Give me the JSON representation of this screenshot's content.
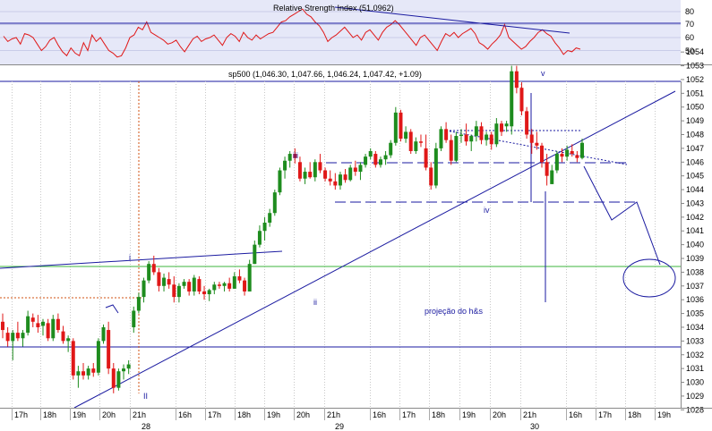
{
  "colors": {
    "rsi_bg": "#e6e8f8",
    "rsi_line": "#e01818",
    "up_candle": "#1e8c1e",
    "down_candle": "#e01818",
    "trendline": "#1a1aa0",
    "support_green": "#3cb43c",
    "fib_orange": "#d05010",
    "grid": "#c8c8c8"
  },
  "rsi_panel": {
    "title": "Relative Strength Index (51.0962)",
    "yticks": [
      "80",
      "70",
      "60",
      "50"
    ]
  },
  "price_panel": {
    "title": "sp500 (1,046.30, 1,047.66, 1,046.24, 1,047.42, +1.09)"
  },
  "annotations": {
    "wave_v": "v",
    "wave_iii": "iii",
    "wave_i": "i",
    "wave_ii_small": "ii",
    "wave_iv": "iv",
    "wave_II": "II",
    "projection": "projeção do h&s"
  },
  "chart_data": {
    "type": "candlestick",
    "title": "sp500 (1,046.30, 1,047.66, 1,046.24, 1,047.42, +1.09)",
    "interval": "hourly",
    "ylim": [
      1027.5,
      1055
    ],
    "yticks": [
      1028,
      1029,
      1030,
      1031,
      1032,
      1033,
      1034,
      1035,
      1036,
      1037,
      1038,
      1039,
      1040,
      1041,
      1042,
      1043,
      1044,
      1045,
      1046,
      1047,
      1048,
      1049,
      1050,
      1051,
      1052,
      1053,
      1054
    ],
    "xtick_labels": [
      "17h",
      "18h",
      "19h",
      "20h",
      "21h",
      "16h",
      "17h",
      "18h",
      "19h",
      "20h",
      "21h",
      "16h",
      "17h",
      "18h",
      "19h",
      "20h",
      "21h",
      "16h",
      "17h",
      "18h",
      "19h"
    ],
    "date_labels": [
      "28",
      "29",
      "30"
    ],
    "horizontal_levels": [
      1054.3,
      1038.7,
      1032.0
    ],
    "candles": [
      [
        1034.4,
        1035.0,
        1033.2,
        1033.8
      ],
      [
        1033.6,
        1034.0,
        1032.6,
        1033.0
      ],
      [
        1033.0,
        1033.8,
        1031.6,
        1033.6
      ],
      [
        1033.6,
        1034.4,
        1033.0,
        1033.2
      ],
      [
        1033.2,
        1033.8,
        1032.6,
        1033.6
      ],
      [
        1033.6,
        1035.2,
        1033.4,
        1034.8
      ],
      [
        1034.7,
        1035.0,
        1034.0,
        1034.4
      ],
      [
        1034.3,
        1034.9,
        1033.6,
        1034.0
      ],
      [
        1034.1,
        1034.6,
        1033.4,
        1034.4
      ],
      [
        1034.3,
        1034.6,
        1033.0,
        1033.2
      ],
      [
        1033.2,
        1034.9,
        1033.0,
        1034.6
      ],
      [
        1034.6,
        1035.0,
        1033.6,
        1033.8
      ],
      [
        1033.7,
        1034.1,
        1032.8,
        1033.0
      ],
      [
        1033.0,
        1033.4,
        1032.2,
        1033.2
      ],
      [
        1033.0,
        1033.2,
        1030.2,
        1030.5
      ],
      [
        1030.5,
        1031.2,
        1029.6,
        1030.8
      ],
      [
        1030.8,
        1031.4,
        1030.2,
        1030.5
      ],
      [
        1030.5,
        1031.2,
        1030.2,
        1031.0
      ],
      [
        1031.0,
        1031.4,
        1030.4,
        1030.7
      ],
      [
        1030.7,
        1033.2,
        1030.5,
        1033.0
      ],
      [
        1033.0,
        1034.2,
        1032.8,
        1034.0
      ],
      [
        1033.8,
        1034.4,
        1030.6,
        1031.0
      ],
      [
        1031.0,
        1031.4,
        1029.2,
        1029.6
      ],
      [
        1029.6,
        1031.0,
        1029.4,
        1030.8
      ],
      [
        1030.8,
        1031.3,
        1030.2,
        1031.0
      ],
      [
        1031.0,
        1031.6,
        1030.6,
        1031.3
      ],
      [
        1034.0,
        1035.5,
        1033.6,
        1035.2
      ],
      [
        1035.2,
        1036.5,
        1035.0,
        1036.2
      ],
      [
        1036.2,
        1037.6,
        1035.8,
        1037.4
      ],
      [
        1037.4,
        1038.8,
        1037.2,
        1038.6
      ],
      [
        1038.6,
        1039.2,
        1037.8,
        1038.0
      ],
      [
        1038.0,
        1038.3,
        1036.6,
        1037.0
      ],
      [
        1037.0,
        1037.9,
        1036.6,
        1037.6
      ],
      [
        1037.5,
        1038.0,
        1036.8,
        1037.1
      ],
      [
        1037.1,
        1037.7,
        1035.8,
        1036.2
      ],
      [
        1036.2,
        1037.2,
        1035.8,
        1037.0
      ],
      [
        1037.0,
        1037.5,
        1036.8,
        1037.3
      ],
      [
        1037.3,
        1037.5,
        1036.3,
        1036.6
      ],
      [
        1036.6,
        1037.8,
        1036.3,
        1037.6
      ],
      [
        1037.5,
        1037.7,
        1036.4,
        1036.6
      ],
      [
        1036.6,
        1037.0,
        1036.0,
        1036.4
      ],
      [
        1036.4,
        1036.8,
        1035.9,
        1036.7
      ],
      [
        1036.7,
        1037.3,
        1036.4,
        1037.1
      ],
      [
        1037.1,
        1037.3,
        1036.8,
        1037.0
      ],
      [
        1037.0,
        1037.3,
        1036.6,
        1037.2
      ],
      [
        1037.2,
        1037.6,
        1036.6,
        1036.8
      ],
      [
        1036.8,
        1038.0,
        1036.8,
        1037.7
      ],
      [
        1037.7,
        1038.2,
        1037.2,
        1037.4
      ],
      [
        1037.4,
        1037.6,
        1036.3,
        1036.6
      ],
      [
        1036.6,
        1038.9,
        1036.6,
        1038.6
      ],
      [
        1038.6,
        1040.3,
        1038.6,
        1040.0
      ],
      [
        1040.0,
        1041.4,
        1039.8,
        1041.0
      ],
      [
        1041.0,
        1042.0,
        1040.3,
        1041.6
      ],
      [
        1041.6,
        1042.6,
        1041.3,
        1042.3
      ],
      [
        1042.3,
        1044.0,
        1042.1,
        1043.8
      ],
      [
        1043.8,
        1045.6,
        1043.6,
        1045.4
      ],
      [
        1045.4,
        1046.4,
        1044.8,
        1046.1
      ],
      [
        1046.1,
        1046.8,
        1045.6,
        1046.6
      ],
      [
        1046.6,
        1047.0,
        1045.9,
        1046.3
      ],
      [
        1046.0,
        1046.4,
        1044.6,
        1044.8
      ],
      [
        1044.8,
        1045.6,
        1044.4,
        1045.3
      ],
      [
        1045.3,
        1046.0,
        1044.8,
        1044.9
      ],
      [
        1044.9,
        1046.2,
        1044.6,
        1046.0
      ],
      [
        1046.0,
        1046.6,
        1045.2,
        1045.4
      ],
      [
        1045.4,
        1045.6,
        1044.6,
        1044.8
      ],
      [
        1044.8,
        1045.4,
        1044.3,
        1044.6
      ],
      [
        1044.6,
        1045.2,
        1044.0,
        1044.3
      ],
      [
        1044.3,
        1045.3,
        1044.0,
        1045.1
      ],
      [
        1045.1,
        1045.5,
        1044.5,
        1044.7
      ],
      [
        1044.7,
        1045.8,
        1044.6,
        1045.6
      ],
      [
        1045.6,
        1046.1,
        1045.0,
        1045.3
      ],
      [
        1045.3,
        1046.0,
        1044.7,
        1045.8
      ],
      [
        1045.8,
        1046.6,
        1045.6,
        1046.4
      ],
      [
        1046.4,
        1047.0,
        1046.2,
        1046.8
      ],
      [
        1046.6,
        1046.8,
        1045.6,
        1045.8
      ],
      [
        1045.8,
        1046.4,
        1045.6,
        1046.2
      ],
      [
        1046.2,
        1046.8,
        1045.8,
        1046.5
      ],
      [
        1046.5,
        1047.6,
        1046.3,
        1047.4
      ],
      [
        1047.4,
        1050.0,
        1047.2,
        1049.6
      ],
      [
        1049.6,
        1049.8,
        1047.5,
        1047.7
      ],
      [
        1047.7,
        1048.6,
        1047.4,
        1048.2
      ],
      [
        1048.2,
        1048.4,
        1046.6,
        1046.8
      ],
      [
        1046.8,
        1047.8,
        1046.6,
        1047.5
      ],
      [
        1047.5,
        1048.0,
        1047.1,
        1047.4
      ],
      [
        1047.0,
        1048.0,
        1045.4,
        1045.6
      ],
      [
        1045.6,
        1046.0,
        1044.0,
        1044.3
      ],
      [
        1044.3,
        1047.4,
        1044.1,
        1047.0
      ],
      [
        1047.0,
        1048.6,
        1046.8,
        1048.4
      ],
      [
        1048.4,
        1048.9,
        1047.4,
        1047.6
      ],
      [
        1047.6,
        1048.0,
        1045.8,
        1046.1
      ],
      [
        1046.1,
        1048.2,
        1046.0,
        1047.9
      ],
      [
        1047.9,
        1048.4,
        1047.4,
        1048.0
      ],
      [
        1048.0,
        1048.8,
        1047.2,
        1047.5
      ],
      [
        1047.5,
        1048.0,
        1046.8,
        1047.9
      ],
      [
        1047.9,
        1049.0,
        1047.5,
        1048.6
      ],
      [
        1048.6,
        1048.9,
        1047.3,
        1047.6
      ],
      [
        1047.6,
        1048.2,
        1047.2,
        1048.0
      ],
      [
        1048.0,
        1048.2,
        1046.9,
        1047.3
      ],
      [
        1047.3,
        1049.2,
        1047.1,
        1048.8
      ],
      [
        1048.8,
        1049.0,
        1047.9,
        1048.2
      ],
      [
        1048.6,
        1049.0,
        1048.2,
        1048.8
      ],
      [
        1048.6,
        1053.0,
        1048.0,
        1052.6
      ],
      [
        1052.6,
        1053.0,
        1051.0,
        1051.4
      ],
      [
        1051.4,
        1051.8,
        1049.4,
        1049.7
      ],
      [
        1049.7,
        1050.0,
        1047.7,
        1048.0
      ],
      [
        1048.0,
        1048.4,
        1046.6,
        1047.4
      ],
      [
        1047.4,
        1048.2,
        1046.9,
        1047.2
      ],
      [
        1047.2,
        1047.4,
        1045.6,
        1046.0
      ],
      [
        1046.0,
        1046.6,
        1044.3,
        1045.0
      ],
      [
        1044.4,
        1045.8,
        1044.4,
        1045.4
      ],
      [
        1045.4,
        1046.8,
        1045.2,
        1046.6
      ],
      [
        1046.6,
        1047.0,
        1046.0,
        1046.4
      ],
      [
        1046.4,
        1047.2,
        1046.1,
        1046.9
      ],
      [
        1046.8,
        1047.3,
        1046.4,
        1046.6
      ],
      [
        1046.5,
        1046.8,
        1046.0,
        1046.3
      ],
      [
        1046.3,
        1047.7,
        1046.2,
        1047.4
      ]
    ],
    "rsi": [
      61,
      57,
      59,
      60,
      55,
      63,
      62,
      60,
      55,
      50,
      53,
      58,
      60,
      54,
      49,
      46,
      52,
      48,
      46,
      56,
      50,
      62,
      57,
      60,
      55,
      50,
      48,
      45,
      46,
      52,
      60,
      62,
      68,
      66,
      72,
      64,
      62,
      60,
      58,
      55,
      56,
      58,
      53,
      49,
      54,
      59,
      61,
      57,
      59,
      60,
      62,
      58,
      54,
      60,
      63,
      61,
      57,
      64,
      60,
      58,
      62,
      59,
      61,
      63,
      64,
      68,
      72,
      73,
      76,
      78,
      80,
      82,
      78,
      76,
      72,
      69,
      64,
      57,
      60,
      62,
      65,
      68,
      64,
      60,
      62,
      58,
      64,
      66,
      62,
      58,
      64,
      68,
      70,
      73,
      70,
      66,
      62,
      58,
      54,
      60,
      62,
      58,
      54,
      50,
      57,
      63,
      61,
      64,
      60,
      63,
      65,
      67,
      63,
      56,
      54,
      51,
      55,
      58,
      62,
      70,
      60,
      57,
      54,
      51,
      53,
      57,
      60,
      64,
      66,
      63,
      61,
      56,
      52,
      47,
      50,
      49,
      52,
      51
    ]
  }
}
